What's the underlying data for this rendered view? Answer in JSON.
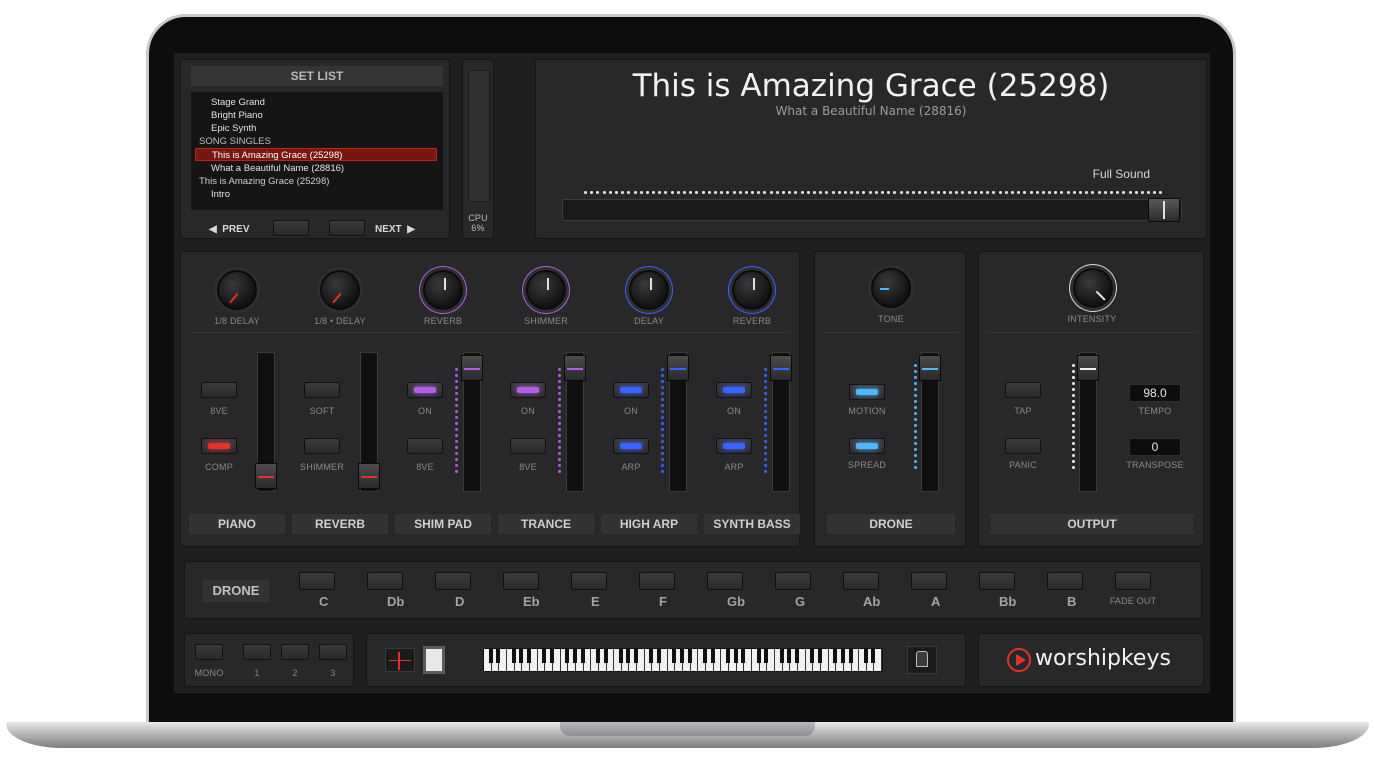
{
  "setlist": {
    "header": "SET LIST",
    "items": [
      {
        "label": "Stage Grand",
        "indent": true,
        "selected": false
      },
      {
        "label": "Bright Piano",
        "indent": true,
        "selected": false
      },
      {
        "label": "Epic Synth",
        "indent": true,
        "selected": false
      },
      {
        "label": "SONG SINGLES",
        "indent": false,
        "selected": false
      },
      {
        "label": "This is Amazing Grace (25298)",
        "indent": true,
        "selected": true
      },
      {
        "label": "What a Beautiful Name (28816)",
        "indent": true,
        "selected": false
      },
      {
        "label": "This is Amazing Grace (25298)",
        "indent": false,
        "selected": false
      },
      {
        "label": "Intro",
        "indent": true,
        "selected": false
      }
    ],
    "prev_label": "PREV",
    "next_label": "NEXT"
  },
  "cpu": {
    "label": "CPU",
    "value": "6%"
  },
  "now_playing": {
    "title": "This is Amazing Grace (25298)",
    "next": "What a Beautiful Name (28816)",
    "sound_label": "Full Sound"
  },
  "channels": [
    {
      "name": "PIANO",
      "knobs": [
        "1/8 DELAY",
        "1/8 • DELAY"
      ]
    },
    {
      "name": "REVERB"
    },
    {
      "name": "SHIM PAD",
      "knobs": [
        "REVERB",
        "SHIMMER"
      ]
    },
    {
      "name": "TRANCE"
    },
    {
      "name": "HIGH ARP",
      "knobs": [
        "DELAY",
        "REVERB"
      ]
    },
    {
      "name": "SYNTH BASS"
    }
  ],
  "knob_labels": [
    "1/8 DELAY",
    "1/8 • DELAY",
    "REVERB",
    "SHIMMER",
    "DELAY",
    "REVERB"
  ],
  "button_labels": {
    "piano_top": "8VE",
    "piano_bot": "COMP",
    "reverb_top": "SOFT",
    "reverb_bot": "SHIMMER",
    "shim_top": "ON",
    "shim_bot": "8VE",
    "trance_top": "ON",
    "trance_bot": "8VE",
    "arp_top": "ON",
    "arp_bot": "ARP",
    "bass_top": "ON",
    "bass_bot": "ARP"
  },
  "drone_panel": {
    "knob": "TONE",
    "btn1": "MOTION",
    "btn2": "SPREAD",
    "name": "DRONE"
  },
  "output_panel": {
    "knob": "INTENSITY",
    "btn1": "TAP",
    "btn2": "PANIC",
    "name": "OUTPUT",
    "tempo_value": "98.0",
    "tempo_label": "TEMPO",
    "transpose_value": "0",
    "transpose_label": "TRANSPOSE"
  },
  "drone_keys": {
    "label": "DRONE",
    "keys": [
      "C",
      "Db",
      "D",
      "Eb",
      "E",
      "F",
      "Gb",
      "G",
      "Ab",
      "A",
      "Bb",
      "B"
    ],
    "fade_out": "FADE OUT"
  },
  "bottom": {
    "mono": "MONO",
    "presets": [
      "1",
      "2",
      "3"
    ],
    "brand": "worshipkeys"
  },
  "colors": {
    "red": "#e2322a",
    "purple": "#b05ee6",
    "blue": "#3a63ff",
    "cyan": "#4fb7ff",
    "white": "#f1f1f1"
  }
}
